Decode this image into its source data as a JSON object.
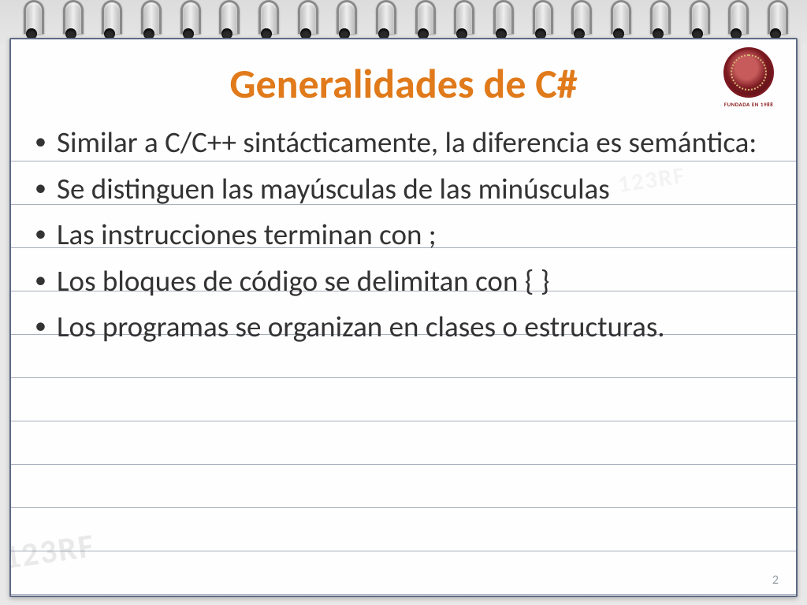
{
  "slide": {
    "title": "Generalidades de C#",
    "bullets": [
      "Similar a C/C++ sintácticamente, la diferencia es semántica:",
      "Se distinguen las mayúsculas de las minúsculas",
      "Las instrucciones terminan con ;",
      "Los bloques de código se delimitan con { }",
      "Los programas se organizan en clases o estructuras."
    ],
    "page_number": "2"
  },
  "logo": {
    "alt": "Universidad del Valle Bolivia",
    "caption": "FUNDADA EN 1988"
  },
  "watermark": "123RF",
  "colors": {
    "title": "#e07a1b",
    "rule": "#5d6a84",
    "logo_red": "#7a1920"
  }
}
